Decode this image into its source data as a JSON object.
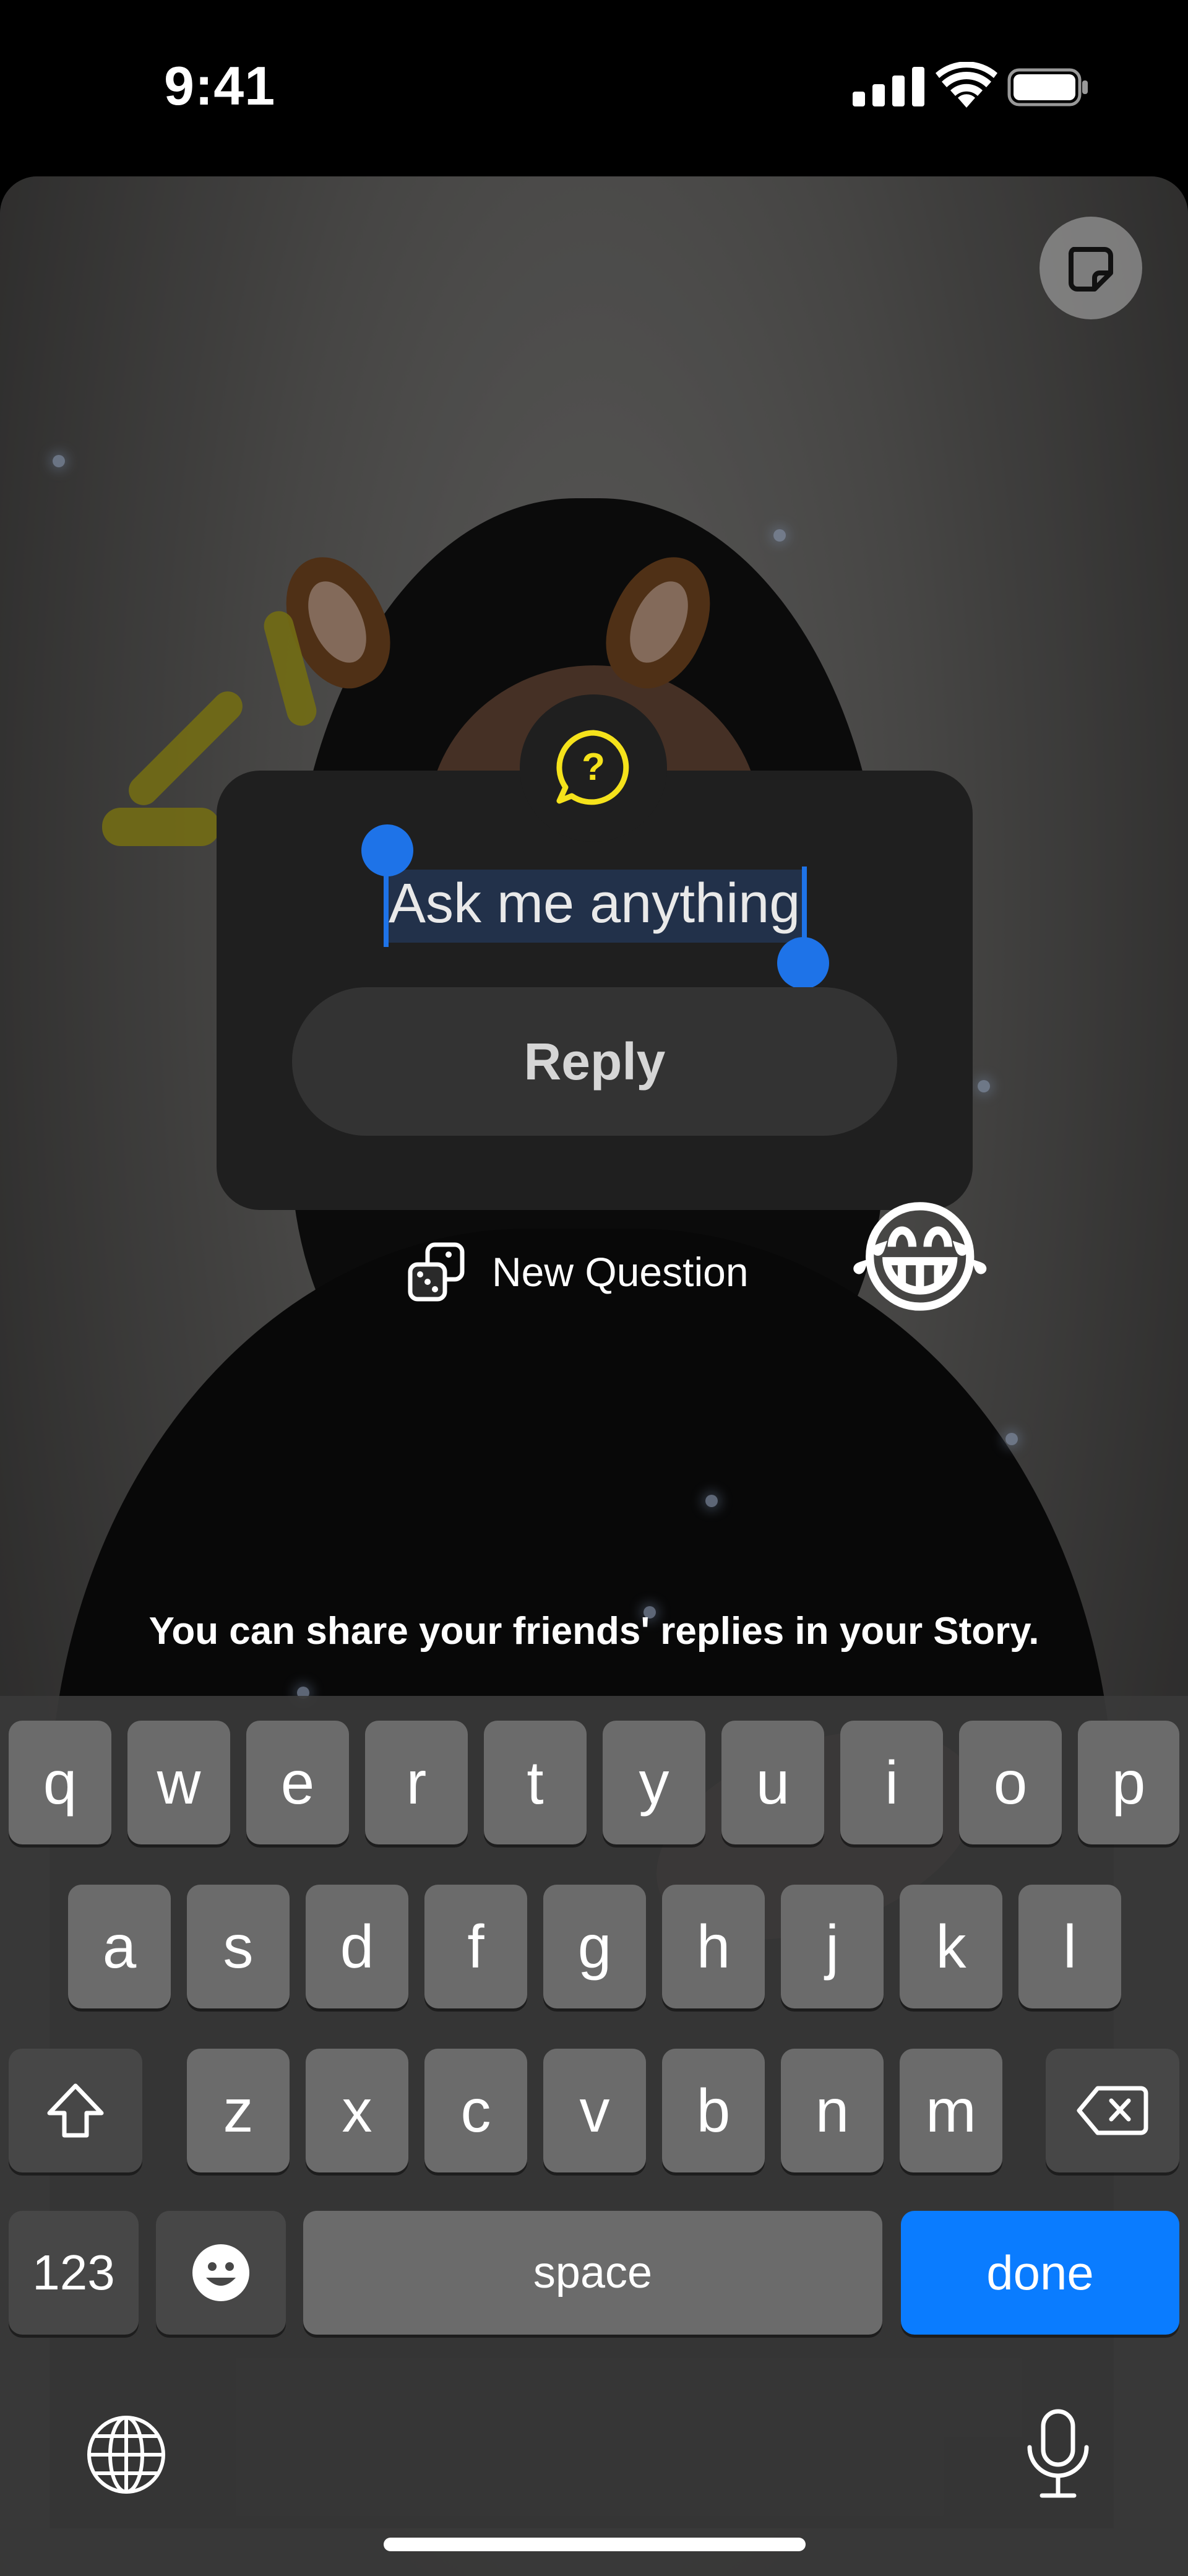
{
  "status_bar": {
    "time": "9:41"
  },
  "question_card": {
    "prompt": "Ask me anything",
    "reply_label": "Reply"
  },
  "new_question_label": "New Question",
  "emoji": "😂",
  "share_note": "You can share your friends' replies in your Story.",
  "keyboard": {
    "row1": [
      "q",
      "w",
      "e",
      "r",
      "t",
      "y",
      "u",
      "i",
      "o",
      "p"
    ],
    "row2": [
      "a",
      "s",
      "d",
      "f",
      "g",
      "h",
      "j",
      "k",
      "l"
    ],
    "row3": [
      "z",
      "x",
      "c",
      "v",
      "b",
      "n",
      "m"
    ],
    "numbers_label": "123",
    "space_label": "space",
    "done_label": "done"
  },
  "colors": {
    "accent": "#0A7CFF",
    "selection_handle": "#1E73E8",
    "question_icon": "#F5E21B"
  }
}
